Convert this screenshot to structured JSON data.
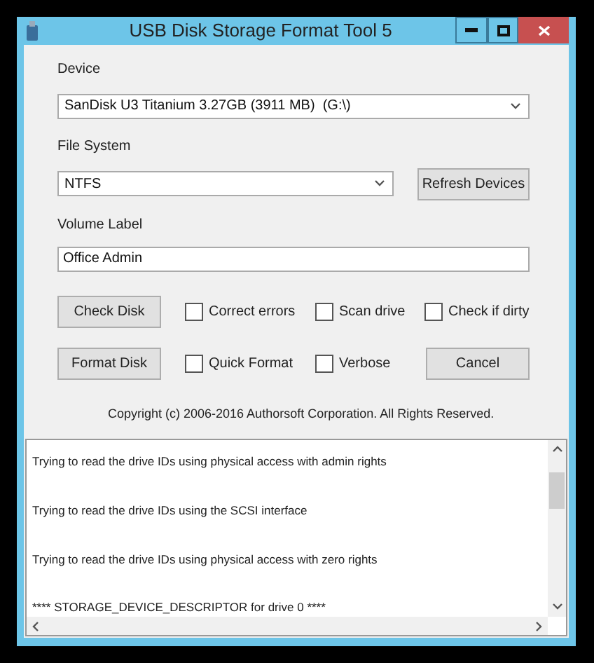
{
  "window": {
    "title": "USB Disk Storage Format Tool 5"
  },
  "device": {
    "label": "Device",
    "value": "SanDisk U3 Titanium 3.27GB (3911 MB)  (G:\\)"
  },
  "file_system": {
    "label": "File System",
    "value": "NTFS"
  },
  "refresh_button": "Refresh Devices",
  "volume_label": {
    "label": "Volume Label",
    "value": "Office Admin"
  },
  "rows": [
    {
      "button": "Check Disk",
      "options": [
        {
          "label": "Correct errors",
          "checked": false
        },
        {
          "label": "Scan drive",
          "checked": false
        },
        {
          "label": "Check if dirty",
          "checked": false
        }
      ]
    },
    {
      "button": "Format Disk",
      "options": [
        {
          "label": "Quick Format",
          "checked": false
        },
        {
          "label": "Verbose",
          "checked": false
        }
      ],
      "end_button": "Cancel"
    }
  ],
  "copyright": "Copyright (c) 2006-2016 Authorsoft Corporation. All Rights Reserved.",
  "log": [
    "Trying to read the drive IDs using physical access with admin rights",
    "Trying to read the drive IDs using the SCSI interface",
    "Trying to read the drive IDs using physical access with zero rights",
    "**** STORAGE_DEVICE_DESCRIPTOR for drive 0 ****"
  ]
}
